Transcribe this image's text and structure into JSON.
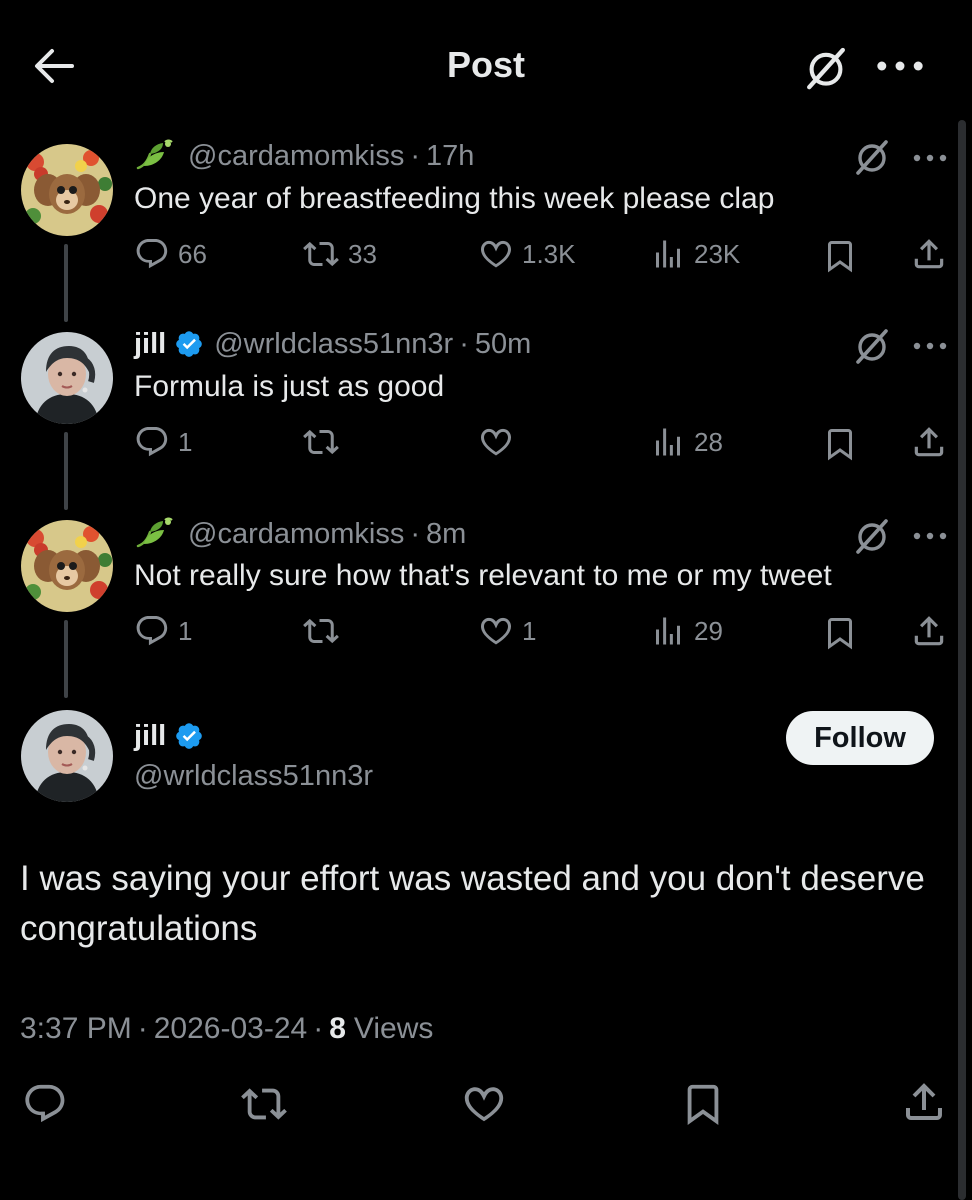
{
  "header": {
    "title": "Post",
    "back_icon": "arrow-left-icon",
    "grok_icon": "grok-icon",
    "more_icon": "more-icon"
  },
  "colors": {
    "background": "#000000",
    "text": "#e7e9ea",
    "muted": "#8b9096",
    "verified": "#1d9bf0",
    "thread_line": "#3f4347",
    "follow_bg": "#eff3f4"
  },
  "thread": [
    {
      "handle": "@cardamomkiss",
      "time": "17h",
      "text": "One year of breastfeeding this week please clap",
      "replies": "66",
      "reposts": "33",
      "likes": "1.3K",
      "views": "23K"
    },
    {
      "name": "jill",
      "handle": "@wrldclass51nn3r",
      "time": "50m",
      "text": "Formula is just as good",
      "replies": "1",
      "reposts": "",
      "likes": "",
      "views": "28"
    },
    {
      "handle": "@cardamomkiss",
      "time": "8m",
      "text": "Not really sure how that's relevant to me or my tweet",
      "replies": "1",
      "reposts": "",
      "likes": "1",
      "views": "29"
    }
  ],
  "focus": {
    "name": "jill",
    "handle": "@wrldclass51nn3r",
    "follow_label": "Follow",
    "text": "I was saying your effort was wasted and you don't deserve congratulations",
    "time": "3:37 PM",
    "date": "2026-03-24",
    "views_count": "8",
    "views_label": "Views"
  }
}
